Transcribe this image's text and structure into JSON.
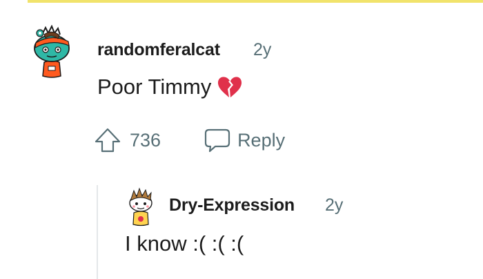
{
  "comment": {
    "author": "randomferalcat",
    "age": "2y",
    "text": "Poor Timmy",
    "emoji_icon": "broken-heart-icon",
    "votes": "736",
    "reply_label": "Reply"
  },
  "reply": {
    "author": "Dry-Expression",
    "age": "2y",
    "text": "I know :( :( :("
  },
  "colors": {
    "highlight": "#f1e36b",
    "meta_text": "#576f76",
    "primary_text": "#1c1c1c",
    "heart": "#e0314b",
    "thread_line": "#e4e7e9"
  }
}
